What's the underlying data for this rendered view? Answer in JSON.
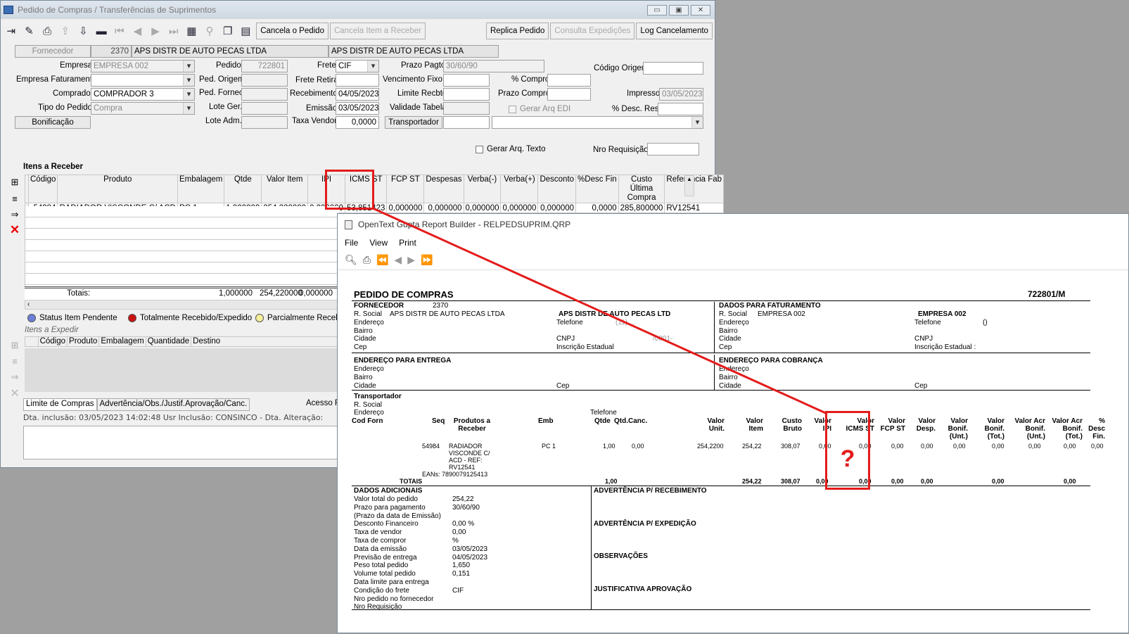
{
  "win1": {
    "title": "Pedido de Compras / Transferências de Suprimentos",
    "win_buttons": [
      "▭",
      "▣",
      "✕"
    ]
  },
  "toolbar": {
    "cancel_order": "Cancela o Pedido",
    "cancel_item": "Cancela Item a Receber",
    "replicate": "Replica Pedido",
    "consult": "Consulta Expedições",
    "log": "Log Cancelamento"
  },
  "header": {
    "fornecedor_btn": "Fornecedor",
    "fornecedor_code": "2370",
    "fornecedor_name": "APS DISTR DE AUTO PECAS LTDA",
    "fornecedor_name2": "APS DISTR DE AUTO PECAS LTDA",
    "empresa_lbl": "Empresa",
    "empresa": "EMPRESA 002",
    "emp_fat_lbl": "Empresa Faturamento",
    "comprador_lbl": "Comprador",
    "comprador": "COMPRADOR 3",
    "tipo_lbl": "Tipo do Pedido",
    "tipo": "Compra",
    "bonificacao": "Bonificação",
    "pedido_lbl": "Pedido",
    "pedido": "722801",
    "ped_origem_lbl": "Ped. Origem",
    "ped_fornec_lbl": "Ped. Fornec",
    "lote_ger_lbl": "Lote Ger.",
    "lote_adm_lbl": "Lote Adm.",
    "frete_lbl": "Frete",
    "frete": "CIF",
    "frete_retira_lbl": "Frete Retira",
    "recebimento_lbl": "Recebimento",
    "recebimento": "04/05/2023",
    "emissao_lbl": "Emissão",
    "emissao": "03/05/2023",
    "taxa_vendor_lbl": "Taxa Vendor",
    "taxa_vendor": "0,0000",
    "prazo_lbl": "Prazo Pagto",
    "prazo": "30/60/90",
    "venc_fixo_lbl": "Vencimento Fixo",
    "limite_lbl": "Limite Recbto",
    "validade_lbl": "Validade Tabela",
    "transportador_btn": "Transportador",
    "pct_compror_lbl": "% Compror",
    "prazo_compror_lbl": "Prazo Compror",
    "gerar_edi": "Gerar Arq EDI",
    "codigo_origem_lbl": "Código Origem",
    "impresso_lbl": "Impresso",
    "impresso": "03/05/2023",
    "desc_res_lbl": "% Desc. Res.",
    "gerar_texto": "Gerar Arq. Texto",
    "nro_req_lbl": "Nro Requisição"
  },
  "itens": {
    "title": "Itens a Receber",
    "columns": [
      "Código",
      "Produto",
      "Embalagem",
      "Qtde",
      "Valor Item",
      "IPI",
      "ICMS ST",
      "FCP ST",
      "Despesas",
      "Verba(-)",
      "Verba(+)",
      "Desconto",
      "%Desc Fin",
      "Custo Última Compra",
      "Referência Fab"
    ],
    "row": [
      "54984",
      "RADIADOR VISCONDE C/ ACD",
      "PC  1",
      "1,000000",
      "254,220000",
      "0,000000",
      "53,851423",
      "0,000000",
      "0,000000",
      "0,000000",
      "0,000000",
      "0,000000",
      "0,0000",
      "285,800000",
      "RV12541"
    ],
    "totais_lbl": "Totais:",
    "totais": [
      "1,000000",
      "254,220000",
      "0,000000"
    ]
  },
  "legend": {
    "pendente": "Status Item Pendente",
    "total": "Totalmente Recebido/Expedido",
    "parcial": "Parcialmente Recebid"
  },
  "expedir": {
    "title": "Itens a Expedir",
    "columns": [
      "Código",
      "Produto",
      "Embalagem",
      "Quantidade",
      "Destino"
    ]
  },
  "bottom": {
    "tab1": "Limite de Compras",
    "tab2": "Advertência/Obs./Justif.Aprovação/Canc.",
    "acesso": "Acesso F",
    "status": "Dta. inclusão: 03/05/2023 14:02:48 Usr Inclusão: CONSINCO  -  Dta. Alteração:"
  },
  "win2": {
    "title": "OpenText Gupta Report Builder - RELPEDSUPRIM.QRP",
    "menu": [
      "File",
      "View",
      "Print"
    ]
  },
  "report": {
    "title": "PEDIDO DE  COMPRAS",
    "number": "722801/M",
    "fornecedor_lbl": "FORNECEDOR",
    "fornecedor_code": "2370",
    "rsocial_lbl": "R. Social",
    "rsocial": "APS DISTR DE AUTO PECAS LTDA",
    "rsocial2": "APS DISTR DE AUTO PECAS LTD",
    "endereco_lbl": "Endereço",
    "bairro_lbl": "Bairro",
    "cidade_lbl": "Cidade",
    "cep_lbl": "Cep",
    "telefone_lbl": "Telefone",
    "telefone_val": "(11) ...",
    "cnpj_lbl": "CNPJ",
    "cnpj_val": "/0001-",
    "ie_lbl": "Inscrição Estadual",
    "faturamento_lbl": "DADOS PARA FATURAMENTO",
    "empresa": "EMPRESA 002",
    "tel_fat": "()",
    "ie_fat_lbl": "Inscrição Estadual :",
    "entrega_lbl": "ENDEREÇO PARA ENTREGA",
    "cobranca_lbl": "ENDEREÇO PARA COBRANÇA",
    "transp_lbl": "Transportador",
    "cols": [
      "Cod Forn",
      "Seq",
      "Produtos a Receber",
      "Emb",
      "Qtde",
      "Qtd.Canc.",
      "Valor Unit.",
      "Valor Item",
      "Custo Bruto",
      "Valor IPI",
      "Valor ICMS ST",
      "Valor FCP ST",
      "Valor Desp.",
      "Valor Bonif. (Unt.)",
      "Valor Bonif. (Tot.)",
      "Valor Acr Bonif. (Unt.)",
      "Valor Acr Bonif. (Tot.)",
      "% Desc Fin."
    ],
    "item": {
      "seq": "54984",
      "produto": "RADIADOR VISCONDE C/ ACD - REF: RV12541",
      "emb": "PC  1",
      "qtde": "1,00",
      "canc": "0,00",
      "unit": "254,2200",
      "item": "254,22",
      "custo": "308,07",
      "ipi": "0,00",
      "icms": "0,00",
      "fcp": "0,00",
      "desp": "0,00",
      "bunt": "0,00",
      "btot": "0,00",
      "aunt": "0,00",
      "atot": "0,00",
      "desc": "0,00"
    },
    "eans": "EANs: 7890079125413",
    "totais_lbl": "TOTAIS",
    "totais": {
      "qtde": "1,00",
      "item": "254,22",
      "custo": "308,07",
      "ipi": "0,00",
      "icms": "0,00",
      "fcp": "0,00",
      "desp": "0,00",
      "btot": "0,00",
      "atot": "0,00"
    },
    "question": "?",
    "adic_lbl": "DADOS ADICIONAIS",
    "adic": [
      [
        "Valor total do pedido",
        "254,22"
      ],
      [
        "Prazo para pagamento",
        "30/60/90"
      ],
      [
        "(Prazo da data de Emissão)",
        ""
      ],
      [
        "Desconto Financeiro",
        "0,00 %"
      ],
      [
        "Taxa de vendor",
        "0,00"
      ],
      [
        "Taxa de compror",
        "%"
      ],
      [
        "Data da emissão",
        "03/05/2023"
      ],
      [
        "Previsão de entrega",
        "04/05/2023"
      ],
      [
        "Peso total pedido",
        "1,650"
      ],
      [
        "Volume total pedido",
        "0,151"
      ],
      [
        "Data limite para entrega",
        ""
      ],
      [
        "Condição do frete",
        "CIF"
      ],
      [
        "Nro pedido no fornecedor",
        ""
      ],
      [
        "Nro Requisição",
        ""
      ]
    ],
    "adv_receb": "ADVERTÊNCIA P/ RECEBIMENTO",
    "adv_exp": "ADVERTÊNCIA P/ EXPEDIÇÃO",
    "obs": "OBSERVAÇÕES",
    "justif": "JUSTIFICATIVA APROVAÇÃO"
  },
  "colors": {
    "annotation": "#e41b1b"
  }
}
